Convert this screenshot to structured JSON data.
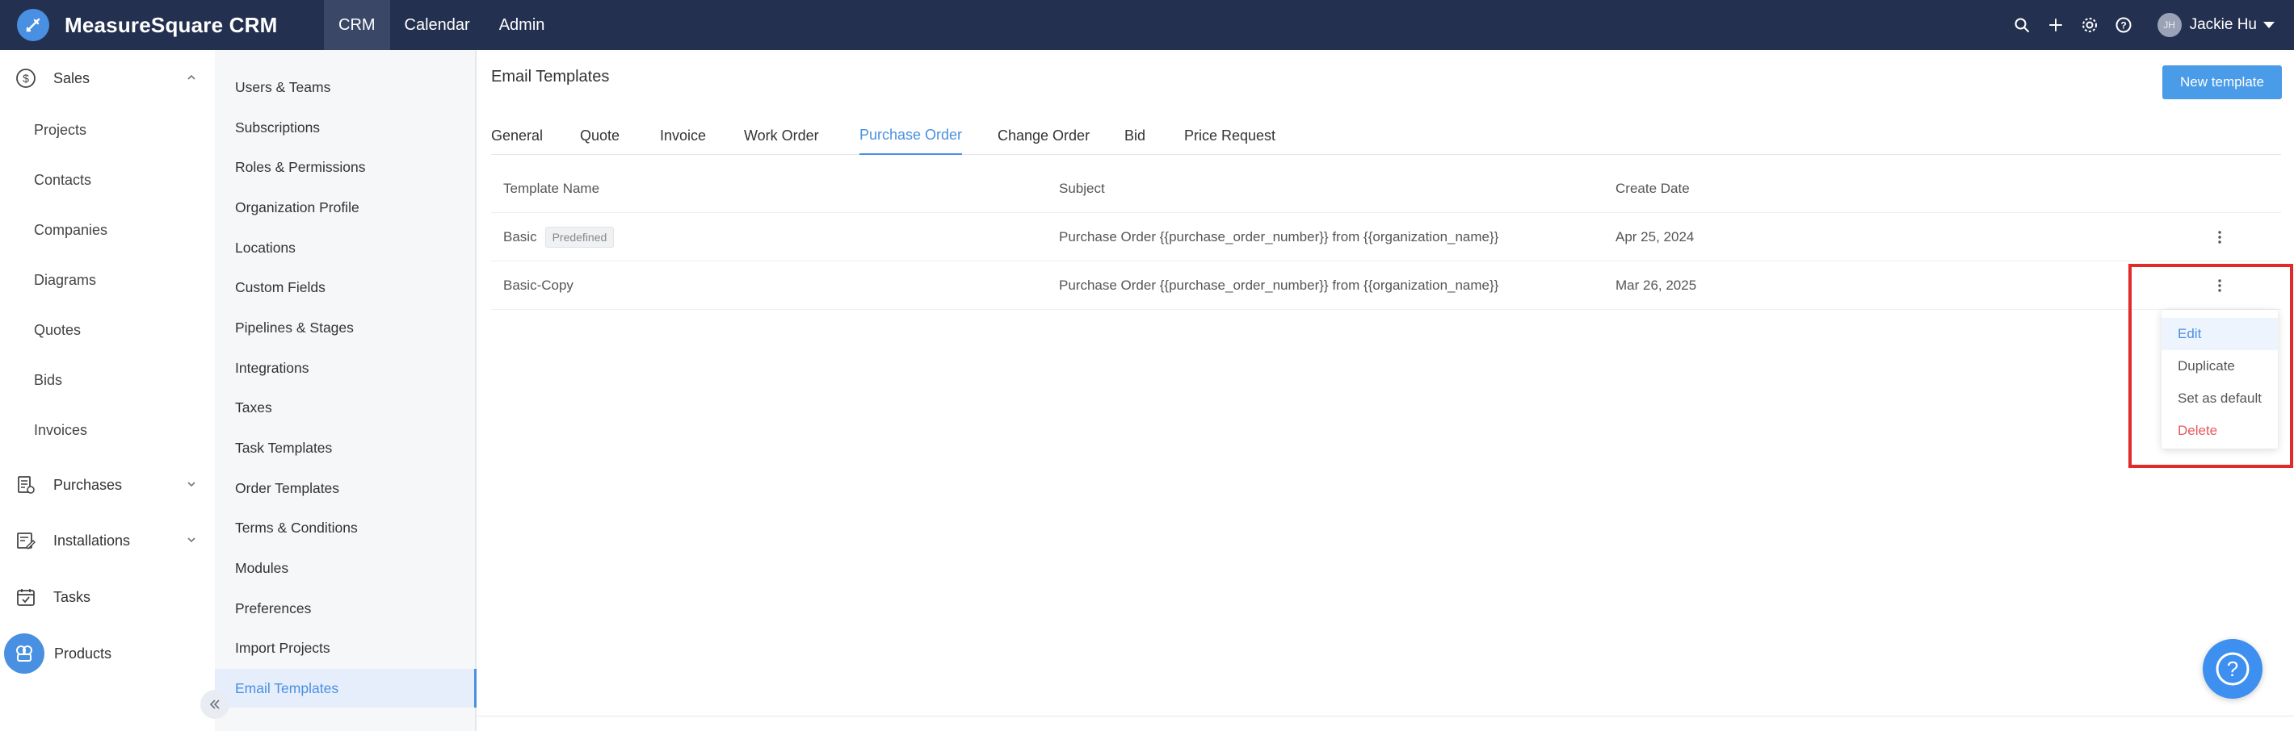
{
  "app": {
    "name": "MeasureSquare CRM",
    "brand_color": "#4a90e2",
    "topbar_color": "#243050"
  },
  "topnav": {
    "items": [
      {
        "label": "CRM",
        "active": true
      },
      {
        "label": "Calendar",
        "active": false
      },
      {
        "label": "Admin",
        "active": false
      }
    ]
  },
  "topbar_icons": [
    "search-icon",
    "plus-icon",
    "gear-icon",
    "help-icon"
  ],
  "user": {
    "initials": "JH",
    "name": "Jackie Hu"
  },
  "sidebar": {
    "sales": {
      "label": "Sales",
      "icon": "dollar-circle-icon",
      "expanded": true
    },
    "sales_items": [
      "Projects",
      "Contacts",
      "Companies",
      "Diagrams",
      "Quotes",
      "Bids",
      "Invoices"
    ],
    "purchases": {
      "label": "Purchases",
      "icon": "receipt-icon"
    },
    "installations": {
      "label": "Installations",
      "icon": "installation-icon"
    },
    "tasks": {
      "label": "Tasks",
      "icon": "calendar-check-icon"
    },
    "products": {
      "label": "Products",
      "icon": "products-icon"
    }
  },
  "settings_nav": {
    "items": [
      "Users & Teams",
      "Subscriptions",
      "Roles & Permissions",
      "Organization Profile",
      "Locations",
      "Custom Fields",
      "Pipelines & Stages",
      "Integrations",
      "Taxes",
      "Task Templates",
      "Order Templates",
      "Terms & Conditions",
      "Modules",
      "Preferences",
      "Import Projects",
      "Email Templates"
    ],
    "active": "Email Templates"
  },
  "main": {
    "title": "Email Templates",
    "new_button": "New template",
    "tabs": [
      "General",
      "Quote",
      "Invoice",
      "Work Order",
      "Purchase Order",
      "Change Order",
      "Bid",
      "Price Request"
    ],
    "active_tab": "Purchase Order",
    "table": {
      "headers": [
        "Template Name",
        "Subject",
        "Create Date"
      ],
      "rows": [
        {
          "name": "Basic",
          "badge": "Predefined",
          "subject": "Purchase Order {{purchase_order_number}} from {{organization_name}}",
          "date": "Apr 25, 2024"
        },
        {
          "name": "Basic-Copy",
          "badge": "",
          "subject": "Purchase Order {{purchase_order_number}} from {{organization_name}}",
          "date": "Mar 26, 2025"
        }
      ]
    }
  },
  "row_menu": {
    "items": [
      {
        "label": "Edit",
        "style": "active"
      },
      {
        "label": "Duplicate",
        "style": "normal"
      },
      {
        "label": "Set as default",
        "style": "normal"
      },
      {
        "label": "Delete",
        "style": "danger"
      }
    ]
  }
}
